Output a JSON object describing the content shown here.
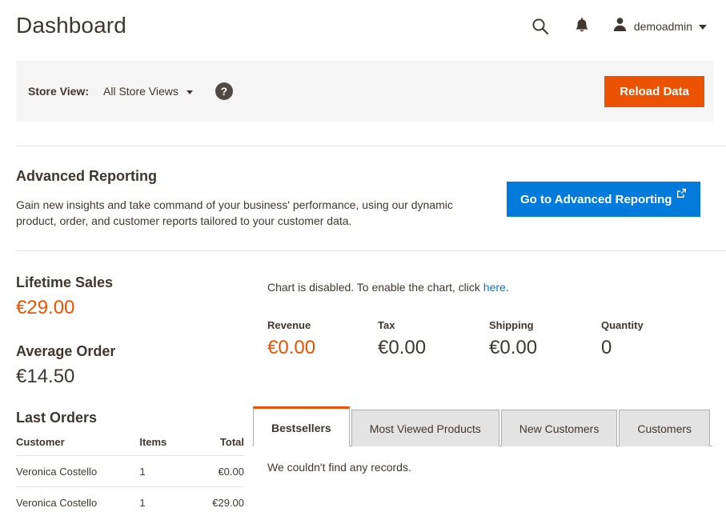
{
  "header": {
    "title": "Dashboard",
    "search_icon": "search-icon",
    "notifications_icon": "bell-icon",
    "user_icon": "user-avatar-icon",
    "user_name": "demoadmin",
    "caret_icon": "chevron-down-icon"
  },
  "store_bar": {
    "label": "Store View:",
    "selected": "All Store Views",
    "help_icon": "question-mark-icon",
    "reload_label": "Reload Data",
    "reload_color": "#eb5202"
  },
  "advanced_reporting": {
    "title": "Advanced Reporting",
    "description": "Gain new insights and take command of your business' performance, using our dynamic product, order, and customer reports tailored to your customer data.",
    "button_label": "Go to Advanced Reporting",
    "button_icon": "external-link-icon",
    "button_color": "#007bdb"
  },
  "left_column": {
    "lifetime_sales": {
      "label": "Lifetime Sales",
      "value": "€29.00",
      "color": "#eb5202"
    },
    "average_order": {
      "label": "Average Order",
      "value": "€14.50",
      "color": "#41362f"
    },
    "last_orders": {
      "title": "Last Orders",
      "columns": [
        "Customer",
        "Items",
        "Total"
      ],
      "rows": [
        {
          "customer": "Veronica Costello",
          "items": "1",
          "total": "€0.00"
        },
        {
          "customer": "Veronica Costello",
          "items": "1",
          "total": "€29.00"
        }
      ]
    }
  },
  "right_column": {
    "chart_message_prefix": "Chart is disabled. To enable the chart, click ",
    "chart_message_link": "here",
    "chart_message_suffix": ".",
    "totals": [
      {
        "label": "Revenue",
        "value": "€0.00",
        "accent": true
      },
      {
        "label": "Tax",
        "value": "€0.00",
        "accent": false
      },
      {
        "label": "Shipping",
        "value": "€0.00",
        "accent": false
      },
      {
        "label": "Quantity",
        "value": "0",
        "accent": false
      }
    ],
    "tabs": [
      {
        "label": "Bestsellers",
        "active": true
      },
      {
        "label": "Most Viewed Products",
        "active": false
      },
      {
        "label": "New Customers",
        "active": false
      },
      {
        "label": "Customers",
        "active": false
      }
    ],
    "tab_panel_message": "We couldn't find any records."
  }
}
